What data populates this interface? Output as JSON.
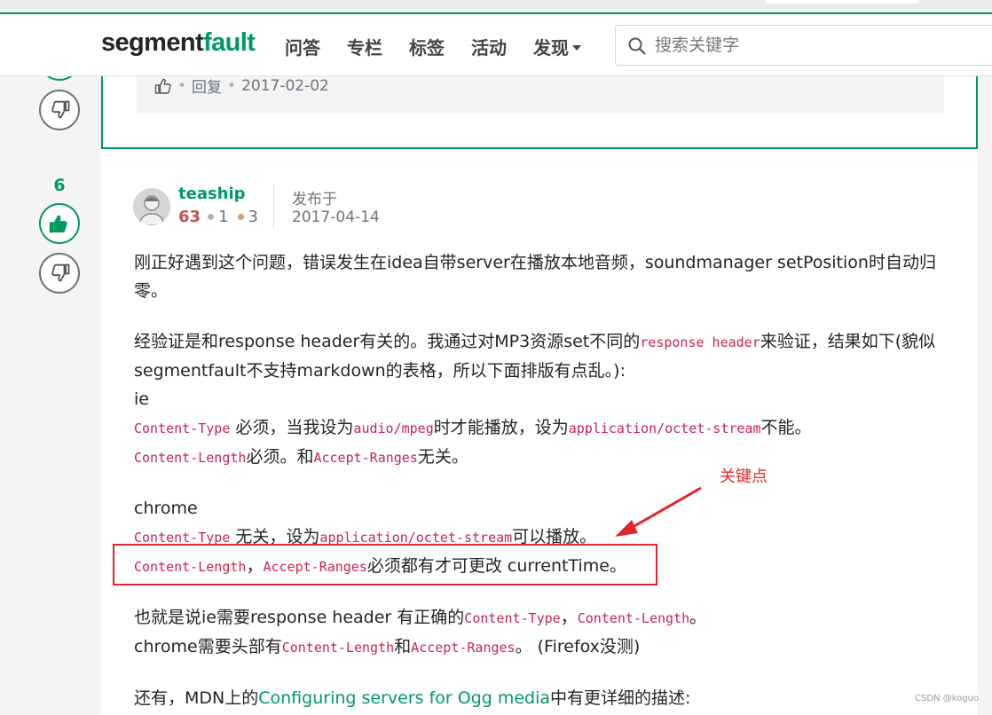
{
  "header": {
    "logo_main": "segment",
    "logo_accent": "fault",
    "nav": [
      "问答",
      "专栏",
      "标签",
      "活动"
    ],
    "nav_dropdown": "发现",
    "search_placeholder": "搜索关键字"
  },
  "prev_comment": {
    "reply_label": "回复",
    "date": "2017-02-02"
  },
  "answer": {
    "vote_count": "6",
    "author": {
      "name": "teaship",
      "reputation": "63",
      "silver_badges": "1",
      "bronze_badges": "3"
    },
    "published_label": "发布于",
    "published_date": "2017-04-14",
    "p1": "刚正好遇到这个问题，错误发生在idea自带server在播放本地音频，soundmanager setPosition时自动归零。",
    "p2_a": "经验证是和response header有关的。我通过对MP3资源set不同的",
    "p2_code": "response header",
    "p2_b": "来验证，结果如下(貌似segmentfault不支持markdown的表格，所以下面排版有点乱。):",
    "ie_title": "ie",
    "ie_l1_code1": "Content-Type",
    "ie_l1_t1": " 必须，当我设为",
    "ie_l1_code2": "audio/mpeg",
    "ie_l1_t2": "时才能播放，设为",
    "ie_l1_code3": "application/octet-stream",
    "ie_l1_t3": "不能。",
    "ie_l2_code1": "Content-Length",
    "ie_l2_t1": "必须。和",
    "ie_l2_code2": "Accept-Ranges",
    "ie_l2_t2": "无关。",
    "chrome_title": "chrome",
    "ch_l1_code1": "Content-Type",
    "ch_l1_t1": " 无关，设为",
    "ch_l1_code2": "application/octet-stream",
    "ch_l1_t2": "可以播放。",
    "ch_l2_code1": "Content-Length",
    "ch_l2_t1": "，",
    "ch_l2_code2": "Accept-Ranges",
    "ch_l2_t2": "必须都有才可更改 currentTime。",
    "s1_t1": "也就是说ie需要response header 有正确的",
    "s1_code1": "Content-Type",
    "s1_t2": "，",
    "s1_code2": "Content-Length",
    "s1_t3": "。",
    "s2_t1": "chrome需要头部有",
    "s2_code1": "Content-Length",
    "s2_t2": "和",
    "s2_code2": "Accept-Ranges",
    "s2_t3": "。 (Firefox没测)",
    "mdn_t1": "还有，MDN上的",
    "mdn_link": "Configuring servers for Ogg media",
    "mdn_t2": "中有更详细的描述:"
  },
  "annotation": {
    "label": "关键点",
    "color": "#e0272c"
  },
  "watermark": "CSDN @koguo",
  "colors": {
    "brand": "#009a61",
    "code": "#c7254e",
    "reputation": "#c0554b"
  },
  "icons": [
    "search-icon",
    "thumbs-up-icon",
    "thumbs-down-icon",
    "like-icon",
    "avatar-icon",
    "caret-down-icon"
  ]
}
